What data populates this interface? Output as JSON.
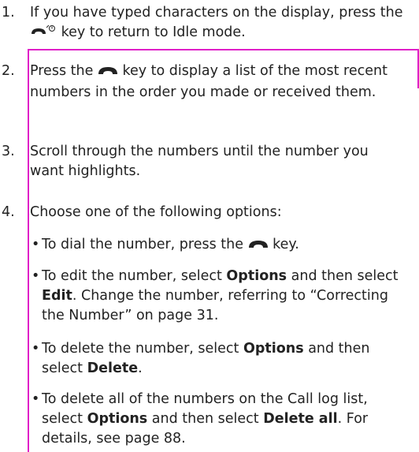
{
  "steps": [
    {
      "num": "1.",
      "before": "If you have typed characters on the display, press the ",
      "after": " key to return to Idle mode."
    },
    {
      "num": "2.",
      "before": "Press the ",
      "after": " key to display a list of the most recent numbers in the order you made or received them."
    },
    {
      "num": "3.",
      "text": "Scroll through the numbers until the number you want highlights."
    },
    {
      "num": "4.",
      "text": "Choose one of the following options:"
    }
  ],
  "bullets": [
    {
      "dot": "•",
      "before": "To dial the number, press the ",
      "after": " key."
    },
    {
      "dot": "•",
      "t1": "To edit the number, select ",
      "b1": "Options",
      "t2": " and then select ",
      "b2": "Edit",
      "t3": ". Change the number, referring to “Correcting the Number” on page 31."
    },
    {
      "dot": "•",
      "t1": "To delete the number, select ",
      "b1": "Options",
      "t2": " and then select ",
      "b2": "Delete",
      "t3": "."
    },
    {
      "dot": "•",
      "t1": "To delete all of the numbers on the Call log list, select ",
      "b1": "Options",
      "t2": " and then select ",
      "b2": "Delete all",
      "t3": ". For details, see page 88."
    }
  ],
  "colors": {
    "revision_bar": "#e020c8",
    "text": "#222222"
  },
  "icons": {
    "end_key": "end-power-key-icon",
    "send_key": "send-key-icon"
  }
}
